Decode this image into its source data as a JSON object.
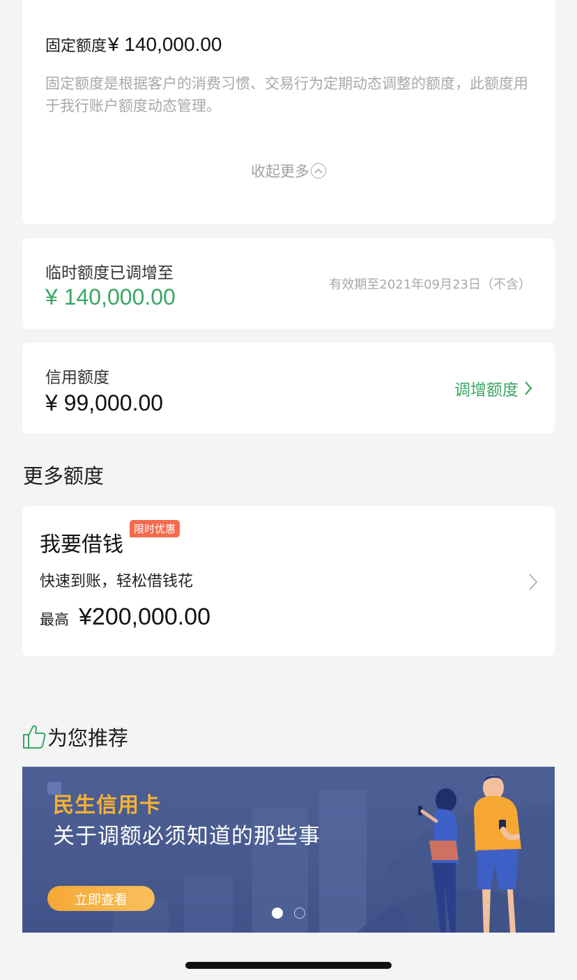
{
  "fixed_limit": {
    "label": "固定额度",
    "value": "¥ 140,000.00",
    "description": "固定额度是根据客户的消费习惯、交易行为定期动态调整的额度，此额度用于我行账户额度动态管理。",
    "collapse_label": "收起更多"
  },
  "temp_limit": {
    "label": "临时额度已调增至",
    "value": "¥ 140,000.00",
    "valid_until": "有效期至2021年09月23日（不含）"
  },
  "credit_limit": {
    "label": "信用额度",
    "value": "¥ 99,000.00",
    "adjust_label": "调增额度"
  },
  "more_limits": {
    "section_title": "更多额度"
  },
  "loan": {
    "title": "我要借钱",
    "badge": "限时优惠",
    "subtitle": "快速到账，轻松借钱花",
    "max_label": "最高",
    "max_value": "¥200,000.00"
  },
  "recommend": {
    "title": "为您推荐",
    "banner": {
      "brand": "民生信用卡",
      "headline": "关于调额必须知道的那些事",
      "cta": "立即查看",
      "active_slide": 1,
      "total_slides": 2
    }
  },
  "colors": {
    "accent_green": "#3aa663",
    "badge_red": "#f46a4b",
    "banner_bg": "#4a5c92",
    "banner_brand": "#f7b232"
  },
  "icons": [
    "chevron-up-circle-icon",
    "chevron-right-icon",
    "thumbs-up-icon"
  ]
}
